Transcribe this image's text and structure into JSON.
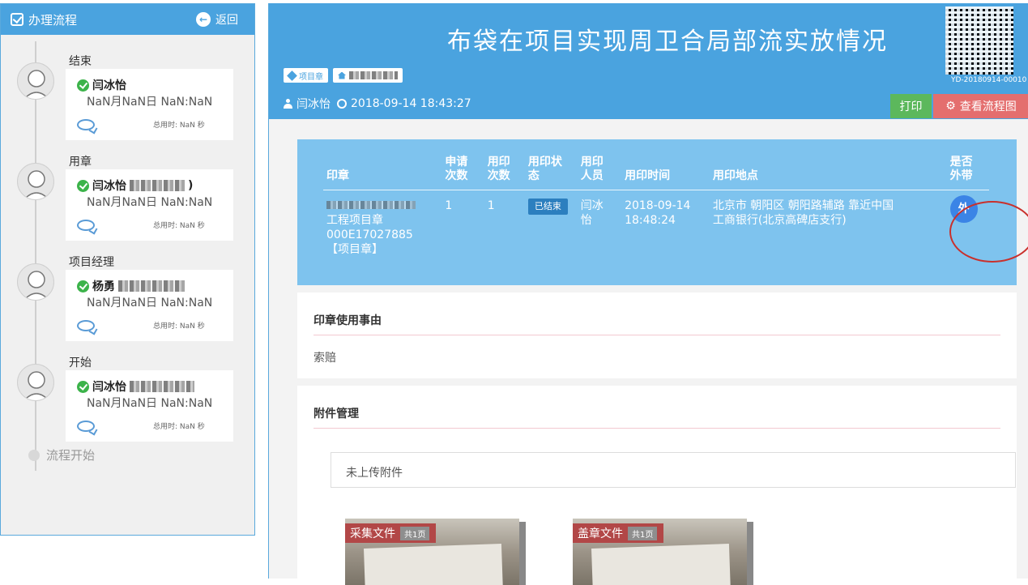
{
  "sidebar": {
    "title": "办理流程",
    "back_label": "返回",
    "steps": [
      {
        "title": "结束",
        "name": "闫冰怡",
        "time": "NaN月NaN日 NaN:NaN",
        "used_label": "总用时: NaN 秒"
      },
      {
        "title": "用章",
        "name": "闫冰怡",
        "suffix": ")",
        "time": "NaN月NaN日 NaN:NaN",
        "used_label": "总用时: NaN 秒"
      },
      {
        "title": "项目经理",
        "name": "杨勇",
        "time": "NaN月NaN日 NaN:NaN",
        "used_label": "总用时: NaN 秒"
      },
      {
        "title": "开始",
        "name": "闫冰怡",
        "time": "NaN月NaN日 NaN:NaN",
        "used_label": "总用时: NaN 秒"
      }
    ],
    "flow_start": "流程开始"
  },
  "header": {
    "title": "布袋在项目实现周卫合局部流实放情况",
    "tag1": "项目章",
    "applicant": "闫冰怡",
    "datetime": "2018-09-14 18:43:27",
    "qr_code_id": "YD-20180914-00010",
    "print_label": "打印",
    "flow_label": "查看流程图"
  },
  "seal_table": {
    "headers": {
      "seal": "印章",
      "apply_count": "申请\n次数",
      "use_count": "用印\n次数",
      "status": "用印状\n态",
      "user": "用印\n人员",
      "use_time": "用印时间",
      "location": "用印地点",
      "take_out": "是否\n外带"
    },
    "row": {
      "seal_line2": "工程项目章",
      "seal_line3": "000E17027885",
      "seal_line4": "【项目章】",
      "apply_count": "1",
      "use_count": "1",
      "status": "已结束",
      "user": "闫冰\n怡",
      "use_date": "2018-09-14",
      "use_clock": "18:48:24",
      "location": "北京市 朝阳区 朝阳路辅路 靠近中国\n工商银行(北京高碑店支行)",
      "take_out": "外"
    }
  },
  "reason": {
    "title": "印章使用事由",
    "value": "索赔"
  },
  "attachments": {
    "title": "附件管理",
    "empty_text": "未上传附件",
    "thumbs": [
      {
        "label": "采集文件",
        "pages": "共1页"
      },
      {
        "label": "盖章文件",
        "pages": "共1页"
      }
    ]
  }
}
